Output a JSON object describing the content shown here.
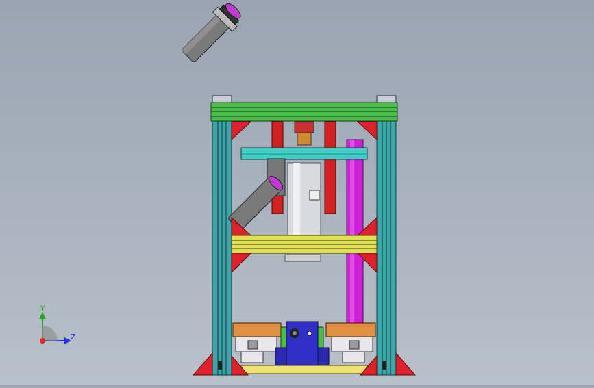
{
  "viewport": {
    "background_top": "#9aa4b2",
    "background_bottom": "#b9c0ca"
  },
  "triad": {
    "y_label": "Y",
    "z_label": "Z",
    "y_color": "#22aa22",
    "z_color": "#2233dd",
    "x_color": "#dd2222"
  },
  "model": {
    "frame_color": "#3aa6a8",
    "top_plate_color": "#46c046",
    "mid_plate_color": "#e0e050",
    "gusset_color": "#e0202c",
    "carrier_plate_color": "#3fd1c8",
    "rod_color": "#d42020",
    "guide_rod_color": "#d020d8",
    "cylinder_color": "#8a8a8a",
    "base_block_color": "#3030c8",
    "slide_block_color": "#e09040",
    "base_plate_color": "#f0e070"
  }
}
